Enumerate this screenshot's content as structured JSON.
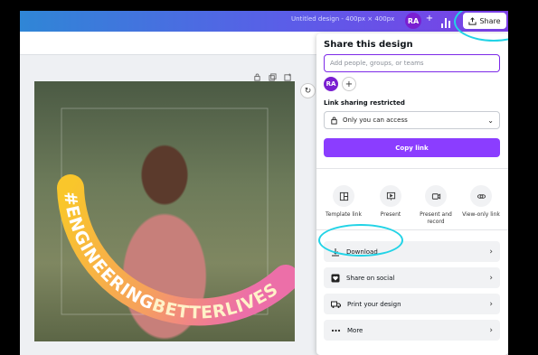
{
  "topbar": {
    "design_title": "Untitled design - 400px × 400px",
    "avatar_initials": "RA",
    "add_label": "+",
    "share_label": "Share"
  },
  "share_panel": {
    "title": "Share this design",
    "people_placeholder": "Add people, groups, or teams",
    "avatar_initials": "RA",
    "add_label": "+",
    "link_restriction_label": "Link sharing restricted",
    "access_value": "Only you can access",
    "copy_link_label": "Copy link",
    "quick_actions": [
      {
        "label": "Template link",
        "icon": "template-link-icon"
      },
      {
        "label": "Present",
        "icon": "present-icon"
      },
      {
        "label": "Present and record",
        "icon": "present-record-icon"
      },
      {
        "label": "View-only link",
        "icon": "view-only-link-icon"
      }
    ],
    "options": [
      {
        "label": "Download",
        "icon": "download-icon"
      },
      {
        "label": "Share on social",
        "icon": "heart-icon"
      },
      {
        "label": "Print your design",
        "icon": "truck-icon"
      },
      {
        "label": "More",
        "icon": "more-dots-icon"
      }
    ]
  },
  "design": {
    "frame_text_1": "#ENGINEERING",
    "frame_text_2": "BETTERLIVES"
  },
  "colors": {
    "accent": "#8b3dff",
    "highlight": "#22d3e6",
    "frame_yellow": "#f9c62b",
    "frame_pink": "#ec6fa8"
  }
}
